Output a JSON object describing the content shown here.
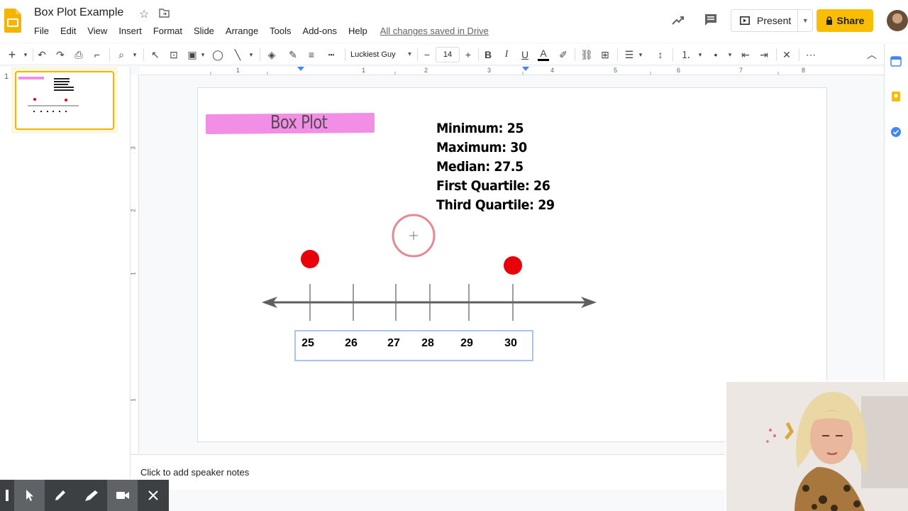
{
  "header": {
    "doc_title": "Box Plot Example",
    "menu": [
      "File",
      "Edit",
      "View",
      "Insert",
      "Format",
      "Slide",
      "Arrange",
      "Tools",
      "Add-ons",
      "Help"
    ],
    "saved_status": "All changes saved in Drive",
    "present_label": "Present",
    "share_label": "Share",
    "accent_color": "#fbbc04"
  },
  "toolbar": {
    "font_name": "Luckiest Guy",
    "font_size": "14",
    "minus": "−",
    "plus": "+"
  },
  "ruler": {
    "h_numbers": [
      "1",
      "1",
      "2",
      "3",
      "4",
      "5",
      "6",
      "7",
      "8"
    ],
    "v_numbers": [
      "3",
      "2",
      "1",
      "1"
    ]
  },
  "filmstrip": {
    "slide_number": "1"
  },
  "slide": {
    "title": "Box Plot",
    "stats": [
      "Minimum: 25",
      "Maximum: 30",
      "Median: 27.5",
      "First Quartile: 26",
      "Third Quartile: 29"
    ],
    "number_line_labels": [
      "25",
      "26",
      "27",
      "28",
      "29",
      "30"
    ],
    "dots_at": [
      "25",
      "30"
    ],
    "dot_color": "#e8000b",
    "title_highlight_color": "#f28ee5"
  },
  "notes": {
    "placeholder": "Click to add speaker notes"
  }
}
